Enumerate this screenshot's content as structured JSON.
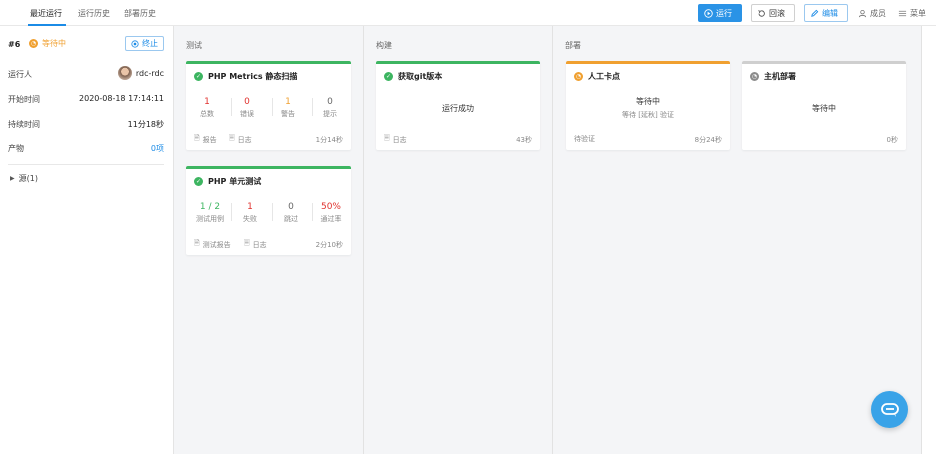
{
  "tabs": [
    "最近运行",
    "运行历史",
    "部署历史"
  ],
  "toolbar": {
    "run": "运行",
    "rollback": "回滚",
    "edit": "编辑",
    "members": "成员",
    "menu": "菜单"
  },
  "run": {
    "id": "#6",
    "status": "等待中",
    "stop": "终止",
    "runner_label": "运行人",
    "runner": "rdc-rdc",
    "start_label": "开始时间",
    "start": "2020-08-18 17:14:11",
    "duration_label": "持续时间",
    "duration": "11分18秒",
    "artifacts_label": "产物",
    "artifacts": "0项",
    "source": "源(1)"
  },
  "stages": {
    "test": "测试",
    "build": "构建",
    "deploy": "部署"
  },
  "jobs": {
    "php_metrics": {
      "title": "PHP Metrics 静态扫描",
      "stats": [
        {
          "value": "1",
          "label": "总数"
        },
        {
          "value": "0",
          "label": "错误"
        },
        {
          "value": "1",
          "label": "警告"
        },
        {
          "value": "0",
          "label": "提示"
        }
      ],
      "report": "报告",
      "log": "日志",
      "time": "1分14秒"
    },
    "php_unit": {
      "title": "PHP 单元测试",
      "stats": [
        {
          "value": "1 / 2",
          "label": "测试用例"
        },
        {
          "value": "1",
          "label": "失败"
        },
        {
          "value": "0",
          "label": "跳过"
        },
        {
          "value": "50%",
          "label": "通过率"
        }
      ],
      "report": "测试报告",
      "log": "日志",
      "time": "2分10秒"
    },
    "git": {
      "title": "获取git版本",
      "message": "运行成功",
      "log": "日志",
      "time": "43秒"
    },
    "manual": {
      "title": "人工卡点",
      "message": "等待中",
      "sub": "等待 [延秋] 验证",
      "pending": "待验证",
      "time": "8分24秒"
    },
    "host_deploy": {
      "title": "主机部署",
      "message": "等待中",
      "time": "0秒"
    }
  },
  "colors": {
    "accent": "#2a93e6",
    "success": "#3db561",
    "warning": "#f0a030",
    "error": "#e0312d",
    "neutral": "#bdbdbd"
  }
}
